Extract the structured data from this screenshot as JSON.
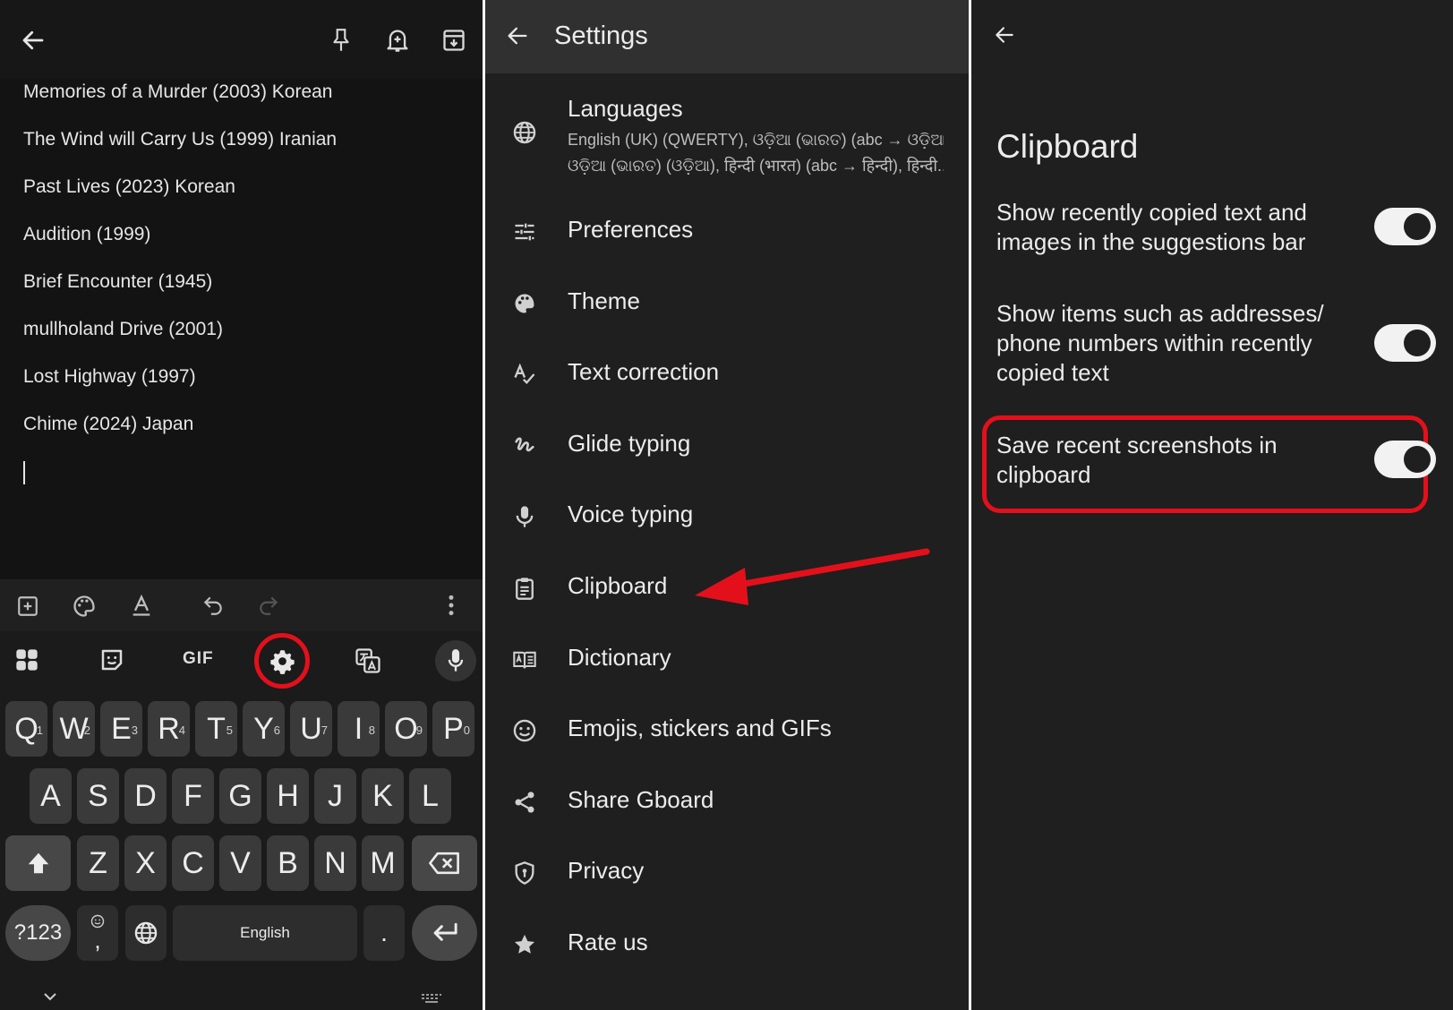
{
  "colors": {
    "highlight": "#e3101b",
    "panel_dark": "#131313",
    "settings_bg": "#1f1f1f",
    "toggle_on": "#f2f2f2"
  },
  "note": {
    "lines": [
      "Memories of a Murder (2003) Korean",
      "The Wind will Carry Us (1999) Iranian",
      "Past Lives (2023) Korean",
      "Audition (1999)",
      "Brief Encounter (1945)",
      "mullholand Drive (2001)",
      "Lost Highway (1997)",
      "Chime (2024) Japan"
    ]
  },
  "keyboard": {
    "gif_label": "GIF",
    "row1": [
      {
        "k": "Q",
        "h": "1"
      },
      {
        "k": "W",
        "h": "2"
      },
      {
        "k": "E",
        "h": "3"
      },
      {
        "k": "R",
        "h": "4"
      },
      {
        "k": "T",
        "h": "5"
      },
      {
        "k": "Y",
        "h": "6"
      },
      {
        "k": "U",
        "h": "7"
      },
      {
        "k": "I",
        "h": "8"
      },
      {
        "k": "O",
        "h": "9"
      },
      {
        "k": "P",
        "h": "0"
      }
    ],
    "row2": [
      "A",
      "S",
      "D",
      "F",
      "G",
      "H",
      "J",
      "K",
      "L"
    ],
    "row3": [
      "Z",
      "X",
      "C",
      "V",
      "B",
      "N",
      "M"
    ],
    "sym_label": "?123",
    "comma_label": ",",
    "space_label": "English",
    "period_label": "."
  },
  "settings": {
    "title": "Settings",
    "languages_label": "Languages",
    "languages_sub1": "English (UK) (QWERTY), ଓଡ଼ିଆ (ଭାରତ) (abc → ଓଡ଼ିଆ),",
    "languages_sub2": "ଓଡ଼ିଆ (ଭାରତ) (ଓଡ଼ିଆ), हिन्दी (भारत) (abc → हिन्दी), हिन्दी...",
    "items": [
      {
        "label": "Preferences",
        "icon": "sliders-icon"
      },
      {
        "label": "Theme",
        "icon": "palette-icon"
      },
      {
        "label": "Text correction",
        "icon": "spellcheck-icon"
      },
      {
        "label": "Glide typing",
        "icon": "gesture-icon"
      },
      {
        "label": "Voice typing",
        "icon": "mic-icon"
      },
      {
        "label": "Clipboard",
        "icon": "clipboard-icon"
      },
      {
        "label": "Dictionary",
        "icon": "dictionary-icon"
      },
      {
        "label": "Emojis, stickers and GIFs",
        "icon": "emoji-icon"
      },
      {
        "label": "Share Gboard",
        "icon": "share-icon"
      },
      {
        "label": "Privacy",
        "icon": "shield-icon"
      },
      {
        "label": "Rate us",
        "icon": "star-icon"
      }
    ]
  },
  "clipboard": {
    "title": "Clipboard",
    "options": [
      {
        "text": "Show recently copied text and images in the suggestions bar",
        "enabled": true
      },
      {
        "text": "Show items such as addresses/ phone numbers within recently copied text",
        "enabled": true
      },
      {
        "text": "Save recent screenshots in clipboard",
        "enabled": true
      }
    ]
  }
}
